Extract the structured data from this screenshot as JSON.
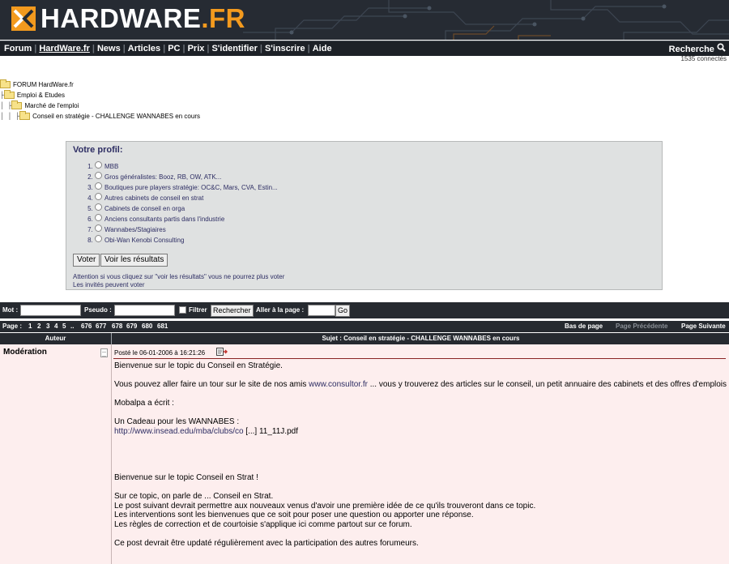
{
  "header": {
    "logo_main": "HARDWARE",
    "logo_suffix": ".FR"
  },
  "nav": {
    "items": [
      "Forum",
      "HardWare.fr",
      "News",
      "Articles",
      "PC",
      "Prix",
      "S'identifier",
      "S'inscrire",
      "Aide"
    ],
    "current": "HardWare.fr",
    "search_label": "Recherche",
    "search_icon": "search-icon"
  },
  "connected": "1535 connectés",
  "breadcrumb": {
    "items": [
      "FORUM HardWare.fr",
      "Emploi & Etudes",
      "Marché de l'emploi",
      "Conseil en stratégie - CHALLENGE WANNABES en cours"
    ]
  },
  "poll": {
    "title": "Votre profil:",
    "options": [
      "MBB",
      "Gros généralistes: Booz, RB, OW, ATK...",
      "Boutiques pure players stratégie: OC&C, Mars, CVA, Estin...",
      "Autres cabinets de conseil en strat",
      "Cabinets de conseil en orga",
      "Anciens consultants partis dans l'industrie",
      "Wannabes/Stagiaires",
      "Obi-Wan Kenobi Consulting"
    ],
    "vote_button": "Voter",
    "results_button": "Voir les résultats",
    "warning": "Attention si vous cliquez sur \"voir les résultats\" vous ne pourrez plus voter",
    "guest_note": "Les invités peuvent voter"
  },
  "search": {
    "mot_label": "Mot :",
    "pseudo_label": "Pseudo :",
    "filter_label": "Filtrer",
    "search_button": "Rechercher",
    "goto_label": "Aller à la page :",
    "go_button": "Go"
  },
  "pagination": {
    "label": "Page :",
    "pages": [
      "1",
      "2",
      "3",
      "4",
      "5",
      "..",
      "676",
      "677",
      "678",
      "679",
      "680",
      "681"
    ],
    "bottom": "Bas de page",
    "prev": "Page Précédente",
    "next": "Page Suivante"
  },
  "table_head": {
    "author": "Auteur",
    "subject": "Sujet : Conseil en stratégie - CHALLENGE WANNABES en cours"
  },
  "post": {
    "author": "Modération",
    "date": "Posté le 06-01-2006 à 16:21:26",
    "body": {
      "l1": "Bienvenue sur le topic du Conseil en Stratégie.",
      "l2a": "Vous pouvez aller faire un tour sur le site de nos amis ",
      "l2link": "www.consultor.fr",
      "l2b": " ... vous y trouverez des articles sur le conseil, un petit annuaire des cabinets et des offres d'emplois",
      "l3": "Mobalpa a écrit :",
      "l4": "Un Cadeau pour les WANNABES :",
      "l5link": "http://www.insead.edu/mba/clubs/co",
      "l5b": " [...] 11_11J.pdf",
      "l6": "Bienvenue sur le topic Conseil en Strat !",
      "l7": "Sur ce topic, on parle de ... Conseil en Strat.",
      "l8": "Le post suivant devrait permettre aux nouveaux venus d'avoir une première idée de ce qu'ils trouveront dans ce topic.",
      "l9": "Les interventions sont les bienvenues que ce soit pour poser une question ou apporter une réponse.",
      "l10": "Les règles de correction et de courtoisie s'applique ici comme partout sur ce forum.",
      "l11": "Ce post devrait être updaté régulièrement avec la participation des autres forumeurs."
    }
  }
}
